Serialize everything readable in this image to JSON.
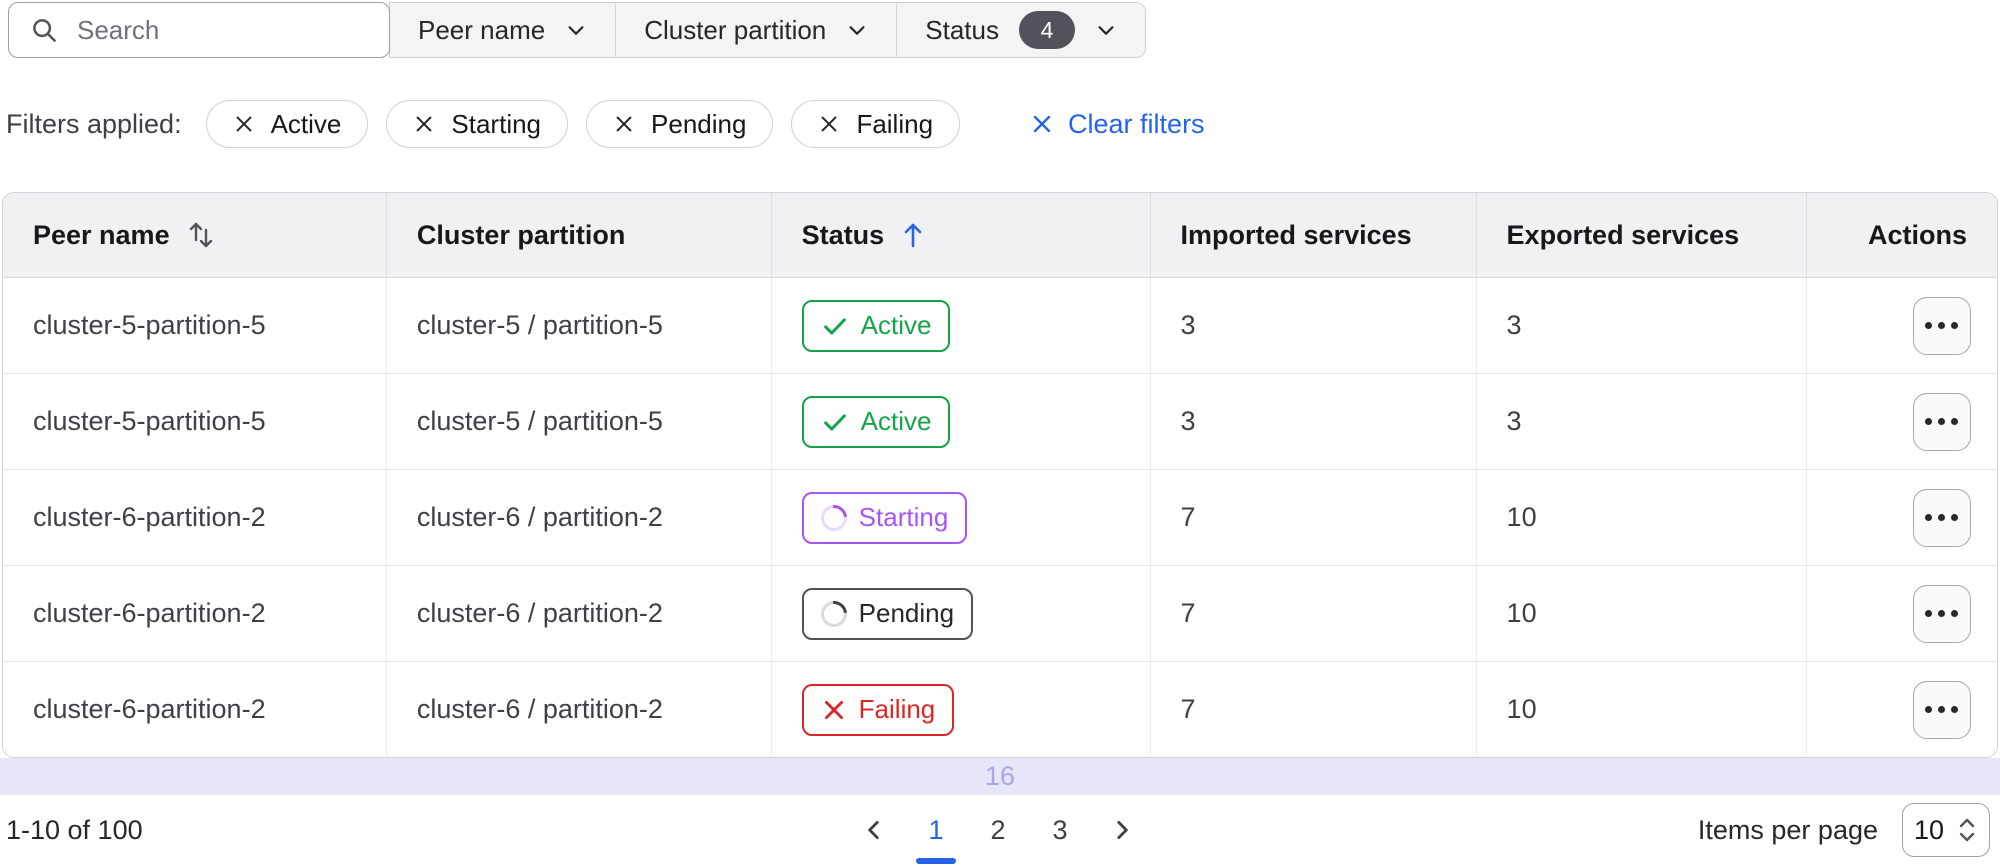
{
  "toolbar": {
    "search": {
      "placeholder": "Search",
      "icon": "search-icon"
    },
    "dropdowns": [
      {
        "label": "Peer name",
        "icon": "chevron-down-icon"
      },
      {
        "label": "Cluster partition",
        "icon": "chevron-down-icon"
      },
      {
        "label": "Status",
        "badge": "4",
        "icon": "chevron-down-icon"
      }
    ]
  },
  "filters": {
    "label": "Filters applied:",
    "chips": [
      "Active",
      "Starting",
      "Pending",
      "Failing"
    ],
    "chip_icon": "x-icon",
    "clear_label": "Clear filters",
    "clear_icon": "x-icon"
  },
  "table": {
    "columns": [
      {
        "label": "Peer name",
        "sort": "sortable",
        "sort_icon": "sort-updown-icon"
      },
      {
        "label": "Cluster partition",
        "sort": "none"
      },
      {
        "label": "Status",
        "sort": "ascending",
        "sort_icon": "arrow-up-icon"
      },
      {
        "label": "Imported services",
        "sort": "none"
      },
      {
        "label": "Exported services",
        "sort": "none"
      },
      {
        "label": "Actions",
        "sort": "none"
      }
    ],
    "rows": [
      {
        "peer_name": "cluster-5-partition-5",
        "cluster_partition": "cluster-5 / partition-5",
        "status": "Active",
        "imported": "3",
        "exported": "3"
      },
      {
        "peer_name": "cluster-5-partition-5",
        "cluster_partition": "cluster-5 / partition-5",
        "status": "Active",
        "imported": "3",
        "exported": "3"
      },
      {
        "peer_name": "cluster-6-partition-2",
        "cluster_partition": "cluster-6 / partition-2",
        "status": "Starting",
        "imported": "7",
        "exported": "10"
      },
      {
        "peer_name": "cluster-6-partition-2",
        "cluster_partition": "cluster-6 / partition-2",
        "status": "Pending",
        "imported": "7",
        "exported": "10"
      },
      {
        "peer_name": "cluster-6-partition-2",
        "cluster_partition": "cluster-6 / partition-2",
        "status": "Failing",
        "imported": "7",
        "exported": "10"
      }
    ],
    "status_icons": {
      "Active": "check-icon",
      "Starting": "spinner-icon",
      "Pending": "spinner-icon",
      "Failing": "x-icon"
    },
    "row_action_icon": "ellipsis-icon",
    "overflow_label": "16"
  },
  "pagination": {
    "range_label": "1-10 of 100",
    "prev_icon": "chevron-left-icon",
    "next_icon": "chevron-right-icon",
    "pages": [
      "1",
      "2",
      "3"
    ],
    "active_page": "1",
    "items_per_page_label": "Items per page",
    "items_per_page_value": "10",
    "items_per_page_icon": "updown-stepper-icon"
  },
  "colors": {
    "status_green": "#16a34a",
    "status_purple": "#a855f7",
    "status_red": "#dc2626",
    "status_pending_border": "#52525b",
    "accent_blue": "#2563eb",
    "count_badge_bg": "#52525b",
    "lavender_bg": "#e6e6f8",
    "lavender_text": "#a5a8e8"
  }
}
